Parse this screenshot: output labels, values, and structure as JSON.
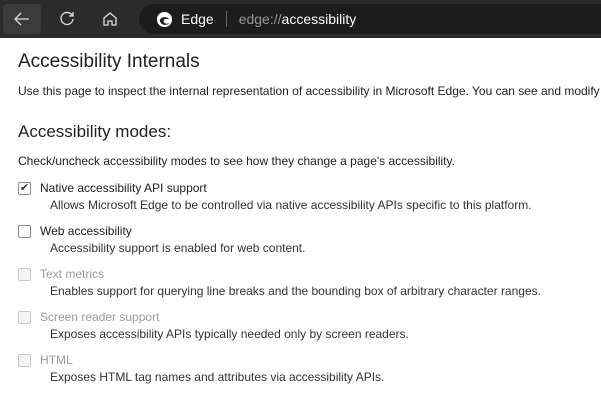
{
  "browser": {
    "brand": "Edge",
    "url_scheme": "edge://",
    "url_path": "accessibility"
  },
  "page": {
    "title": "Accessibility Internals",
    "intro": "Use this page to inspect the internal representation of accessibility in Microsoft Edge. You can see and modify",
    "modes_heading": "Accessibility modes:",
    "modes_help": "Check/uncheck accessibility modes to see how they change a page's accessibility.",
    "modes": [
      {
        "label": "Native accessibility API support",
        "desc": "Allows Microsoft Edge to be controlled via native accessibility APIs specific to this platform.",
        "checked": true,
        "enabled": true
      },
      {
        "label": "Web accessibility",
        "desc": "Accessibility support is enabled for web content.",
        "checked": false,
        "enabled": true
      },
      {
        "label": "Text metrics",
        "desc": "Enables support for querying line breaks and the bounding box of arbitrary character ranges.",
        "checked": false,
        "enabled": false
      },
      {
        "label": "Screen reader support",
        "desc": "Exposes accessibility APIs typically needed only by screen readers.",
        "checked": false,
        "enabled": false
      },
      {
        "label": "HTML",
        "desc": "Exposes HTML tag names and attributes via accessibility APIs.",
        "checked": false,
        "enabled": false
      }
    ]
  }
}
